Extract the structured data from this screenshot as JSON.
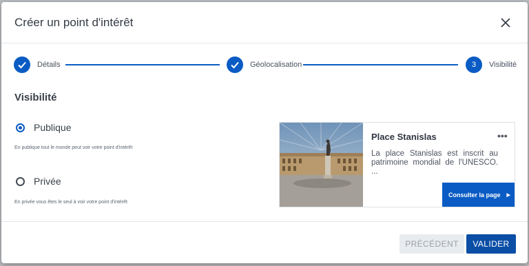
{
  "modal": {
    "title": "Créer un point d'intérêt",
    "close_icon": "close-icon"
  },
  "stepper": {
    "steps": [
      {
        "label": "Détails",
        "state": "done",
        "icon": "check-icon"
      },
      {
        "label": "Géolocalisation",
        "state": "done",
        "icon": "check-icon"
      },
      {
        "label": "Visibilité",
        "state": "current",
        "number": "3"
      }
    ]
  },
  "visibility": {
    "section_title": "Visibilité",
    "options": [
      {
        "label": "Publique",
        "hint": "En publique tout le monde peut voir votre point d'intérêt",
        "checked": true
      },
      {
        "label": "Privée",
        "hint": "En privée vous êtes le seul à voir votre point d'intérêt",
        "checked": false
      }
    ]
  },
  "card": {
    "title": "Place Stanislas",
    "menu_icon": "more-horizontal-icon",
    "description": "La place Stanislas est inscrit au patrimoine mondial de l'UNESCO. ...",
    "button_label": "Consulter la page",
    "button_icon": "caret-right-icon"
  },
  "footer": {
    "prev_label": "PRÉCÉDENT",
    "ok_label": "VALIDER"
  },
  "colors": {
    "accent": "#0a5cc4",
    "primary_button": "#0a4ea6",
    "disabled_button": "#e9ecef"
  }
}
